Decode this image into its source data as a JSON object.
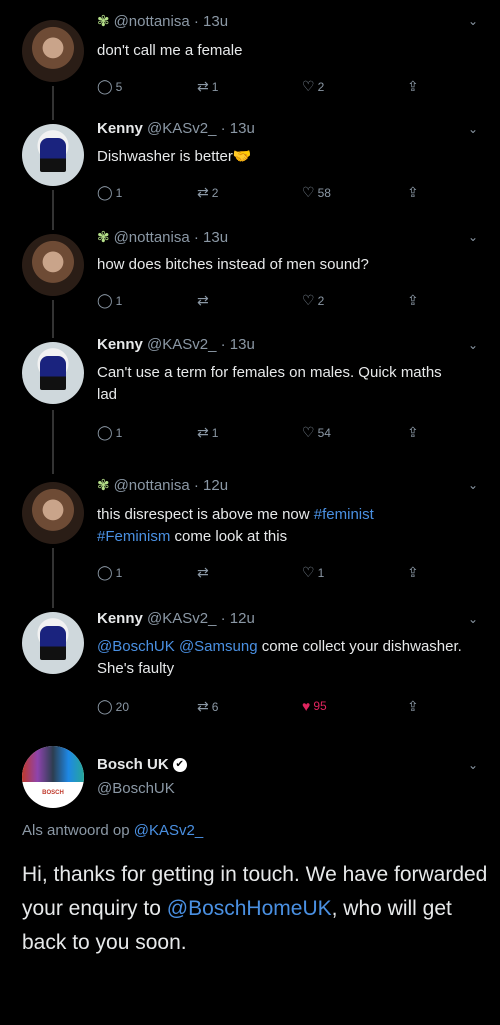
{
  "tweets": [
    {
      "name": "",
      "handle": "@nottanisa",
      "time": "13u",
      "text": "don't call me a female",
      "replies": "5",
      "retweets": "1",
      "likes": "2",
      "avatar": "woman"
    },
    {
      "name": "Kenny",
      "handle": "@KASv2_",
      "time": "13u",
      "text": "Dishwasher is better",
      "emoji": "🤝",
      "replies": "1",
      "retweets": "2",
      "likes": "58",
      "avatar": "kenny"
    },
    {
      "name": "",
      "handle": "@nottanisa",
      "time": "13u",
      "text": "how does bitches instead of men sound?",
      "replies": "1",
      "retweets": "",
      "likes": "2",
      "avatar": "woman"
    },
    {
      "name": "Kenny",
      "handle": "@KASv2_",
      "time": "13u",
      "text": "Can't use a term for females on males. Quick maths lad",
      "replies": "1",
      "retweets": "1",
      "likes": "54",
      "avatar": "kenny"
    },
    {
      "name": "",
      "handle": "@nottanisa",
      "time": "12u",
      "text_prefix": "this disrespect is above me now ",
      "tag1": "#feminist",
      "tag2": "#Feminism",
      "text_suffix": " come look at this",
      "replies": "1",
      "retweets": "",
      "likes": "1",
      "avatar": "woman"
    },
    {
      "name": "Kenny",
      "handle": "@KASv2_",
      "time": "12u",
      "mention1": "@BoschUK",
      "mention2": "@Samsung",
      "text_suffix": " come collect your dishwasher. She's faulty",
      "replies": "20",
      "retweets": "6",
      "likes": "95",
      "avatar": "kenny"
    }
  ],
  "bosch": {
    "name": "Bosch UK",
    "handle": "@BoschUK",
    "avatar_word": "BOSCH",
    "reply_prefix": "Als antwoord op ",
    "reply_to": "@KASv2_",
    "text_1": "Hi, thanks for getting in touch. We have forwarded your enquiry to ",
    "mention": "@BoschHomeUK",
    "text_2": ", who will get back to you soon."
  },
  "icons": {
    "reply": "reply-icon",
    "retweet": "retweet-icon",
    "like": "heart-icon",
    "share": "share-icon",
    "more": "chevron-down-icon",
    "verified": "verified-icon",
    "butterfly": "butterfly-icon"
  },
  "colors": {
    "background": "#000000",
    "link": "#4a90e2",
    "like": "#e0245e",
    "muted": "#8b98a5"
  }
}
